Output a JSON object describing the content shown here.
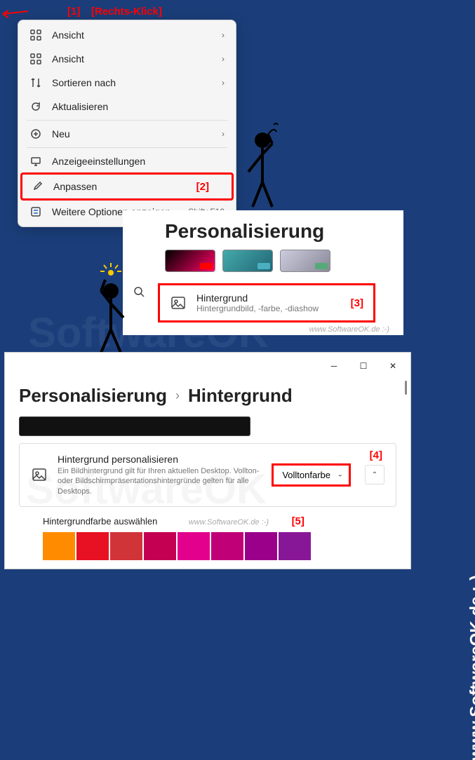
{
  "annotations": {
    "a1": "[1]",
    "a1_label": "[Rechts-Klick]",
    "a2": "[2]",
    "a3": "[3]",
    "a4": "[4]",
    "a5": "[5]"
  },
  "context_menu": {
    "items": [
      {
        "icon": "grid",
        "label": "Ansicht",
        "chevron": true
      },
      {
        "icon": "grid",
        "label": "Ansicht",
        "chevron": true
      },
      {
        "icon": "sort",
        "label": "Sortieren nach",
        "chevron": true
      },
      {
        "icon": "refresh",
        "label": "Aktualisieren"
      },
      {
        "icon": "plus",
        "label": "Neu",
        "chevron": true
      },
      {
        "icon": "display",
        "label": "Anzeigeeinstellungen"
      },
      {
        "icon": "brush",
        "label": "Anpassen",
        "highlighted": true
      },
      {
        "icon": "more",
        "label": "Weitere Optionen anzeigen",
        "shortcut": "Shift+F10"
      }
    ]
  },
  "personalization": {
    "title": "Personalisierung",
    "card": {
      "title": "Hintergrund",
      "sub": "Hintergrundbild, -farbe, -diashow"
    },
    "watermark": "www.SoftwareOK.de :-)"
  },
  "settings": {
    "breadcrumb_a": "Personalisierung",
    "breadcrumb_b": "Hintergrund",
    "card_title": "Hintergrund personalisieren",
    "card_sub": "Ein Bildhintergrund gilt für Ihren aktuellen Desktop. Vollton- oder Bildschirmpräsentationshintergründe gelten für alle Desktops.",
    "dropdown_value": "Volltonfarbe",
    "color_label": "Hintergrundfarbe auswählen",
    "watermark": "www.SoftwareOK.de :-)",
    "colors": [
      "#ff8c00",
      "#e81123",
      "#d13438",
      "#c30052",
      "#e3008c",
      "#bf0077",
      "#9a0089",
      "#881798"
    ]
  },
  "right_watermark": "www.SoftwareOK.de :-)",
  "bg_watermark": "SoftwareOK"
}
